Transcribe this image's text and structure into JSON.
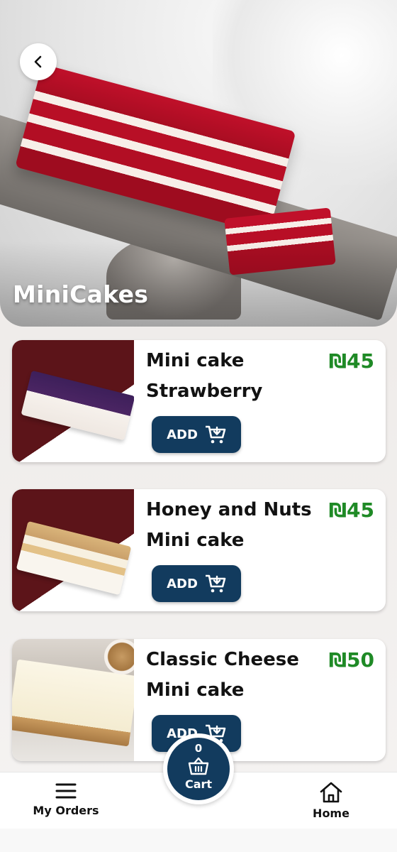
{
  "header": {
    "title": "MiniCakes"
  },
  "products": [
    {
      "name_line1": "Mini cake",
      "name_line2": "Strawberry",
      "price": "₪45",
      "add_label": "ADD"
    },
    {
      "name_line1": "Honey and Nuts",
      "name_line2": "Mini cake",
      "price": "₪45",
      "add_label": "ADD"
    },
    {
      "name_line1": "Classic Cheese",
      "name_line2": "Mini cake",
      "price": "₪50",
      "add_label": "ADD"
    }
  ],
  "nav": {
    "orders_label": "My Orders",
    "home_label": "Home",
    "cart_label": "Cart",
    "cart_count": "0"
  },
  "icons": {
    "back": "chevron-left-icon",
    "add": "cart-add-icon",
    "orders": "menu-icon",
    "cart": "basket-icon",
    "home": "home-icon"
  },
  "colors": {
    "primary": "#123b5e",
    "price": "#1f8a26",
    "card_accent": "#5c1419"
  }
}
